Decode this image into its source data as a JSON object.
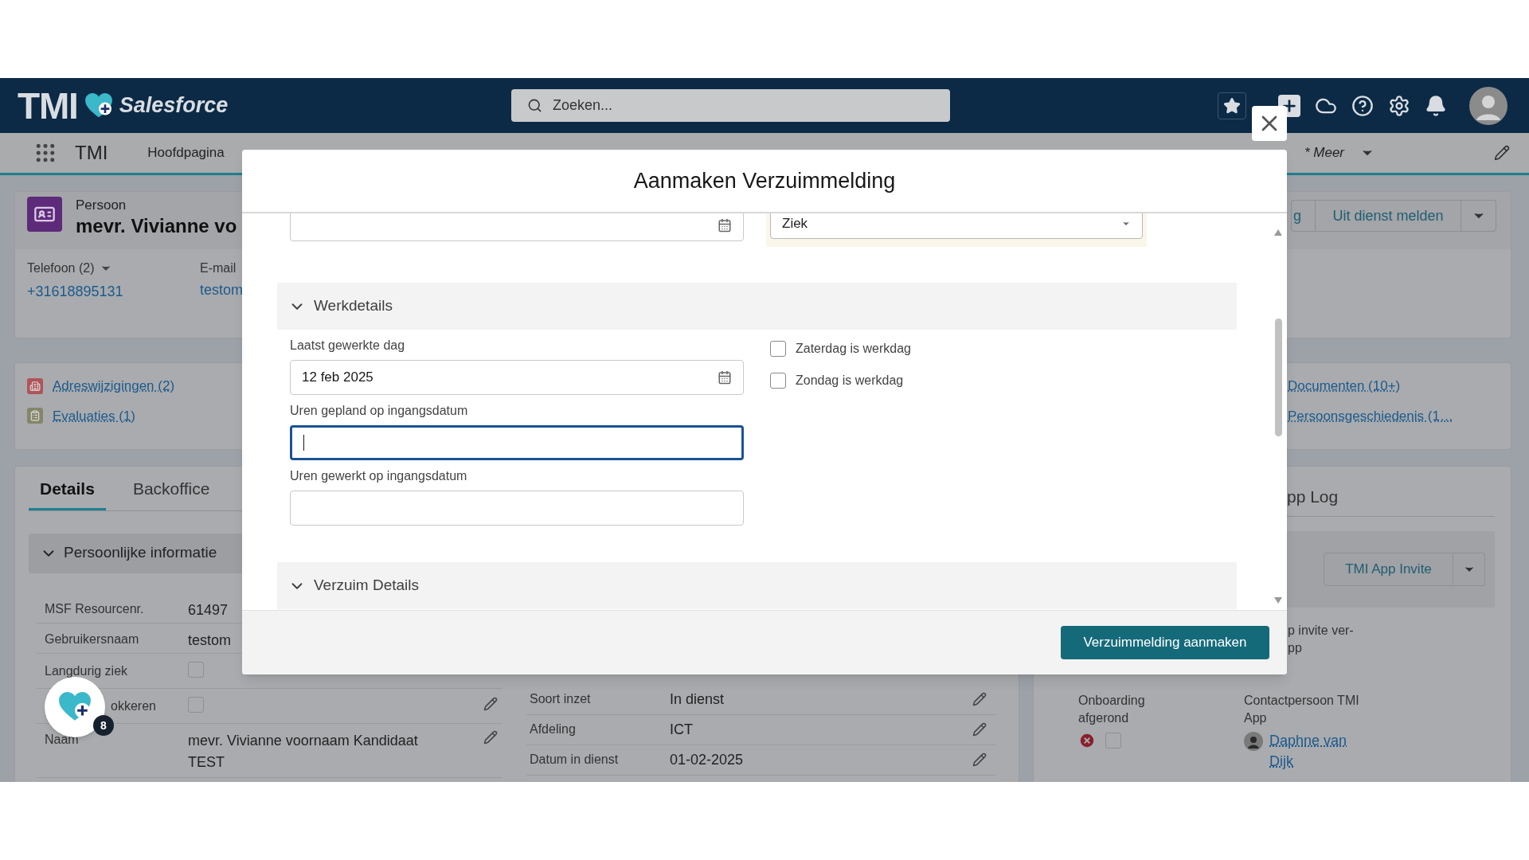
{
  "header": {
    "logo": "TMI",
    "logo_subtext": "Salesforce",
    "search": {
      "placeholder": "Zoeken..."
    }
  },
  "nav": {
    "app_name": "TMI",
    "home": "Hoofdpagina",
    "more": "* Meer"
  },
  "record": {
    "type": "Persoon",
    "name": "mevr. Vivianne vo",
    "phone_label": "Telefoon (2)",
    "phone": "+31618895131",
    "email_label": "E-mail",
    "email": "testom",
    "actions": [
      "g",
      "Uit dienst melden"
    ]
  },
  "related": {
    "left": [
      "Adreswijzigingen (2)",
      "Evaluaties (1)"
    ],
    "right": [
      "Documenten (10+)",
      "Persoonsgeschiedenis (1…"
    ]
  },
  "details": {
    "tabs": [
      {
        "label": "Details",
        "selected": true
      },
      {
        "label": "Backoffice",
        "selected": false
      }
    ],
    "section": {
      "title": "Persoonlijke informatie",
      "expanded": true
    },
    "left_fields": [
      {
        "label": "MSF Resourcenr.",
        "kind": "text",
        "value": "61497",
        "editable": false
      },
      {
        "label": "Gebruikersnaam",
        "kind": "text",
        "value": "testom",
        "editable": false
      },
      {
        "label": "Langdurig ziek",
        "kind": "checkbox",
        "checked": false,
        "editable": false
      },
      {
        "label": "okkeren",
        "kind": "checkbox",
        "checked": false,
        "editable": true
      },
      {
        "label": "Naam",
        "kind": "text",
        "value": "mevr. Vivianne voornaam Kandidaat TEST",
        "editable": true
      }
    ],
    "right_fields": [
      {
        "label": "Soort inzet",
        "value": "In dienst",
        "editable": true
      },
      {
        "label": "Afdeling",
        "value": "ICT",
        "editable": true
      },
      {
        "label": "Datum in dienst",
        "value": "01-02-2025",
        "editable": true
      }
    ]
  },
  "app_log": {
    "tab": "pp Log",
    "invite_button": "TMI App Invite",
    "invite_text": [
      "p invite ver-",
      "pp"
    ],
    "onboarding": {
      "label": "Onboarding afgerond",
      "failed": true,
      "checked": false
    },
    "contact": {
      "label": "Contactpersoon TMI App",
      "name": "Daphne van Dijk"
    }
  },
  "floating_badge": "8",
  "modal": {
    "title": "Aanmaken Verzuimmelding",
    "select_value": "Ziek",
    "sections": [
      {
        "title": "Werkdetails",
        "expanded": true
      },
      {
        "title": "Verzuim Details",
        "expanded": true
      }
    ],
    "fields": [
      {
        "label": "Laatst gewerkte dag",
        "kind": "date",
        "value": "12 feb 2025",
        "focused": false
      },
      {
        "label": "Uren gepland op ingangsdatum",
        "kind": "number",
        "focused": true
      },
      {
        "label": "Uren gewerkt op ingangsdatum",
        "kind": "number",
        "focused": false
      }
    ],
    "checkboxes": [
      {
        "label": "Zaterdag is werkdag",
        "checked": false
      },
      {
        "label": "Zondag is werkdag",
        "checked": false
      }
    ],
    "submit": "Verzuimmelding aanmaken"
  }
}
